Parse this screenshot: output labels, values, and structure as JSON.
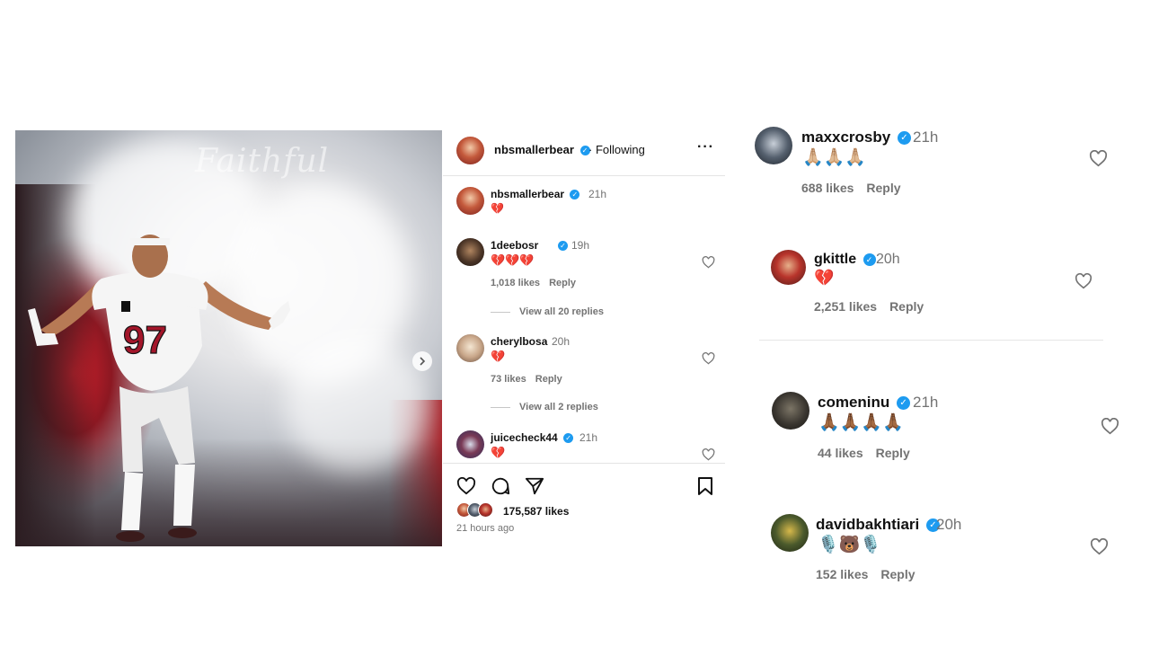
{
  "post": {
    "author": "nbsmallerbear",
    "follow_state": "· Following",
    "more_label": "···",
    "caption_emoji": "💔",
    "caption_time": "21h",
    "likes": "175,587 likes",
    "time_ago": "21 hours ago",
    "photo_banner": "Faithful"
  },
  "comments": [
    {
      "user": "1deebosr",
      "time": "19h",
      "text": "💔💔💔",
      "likes": "1,018 likes",
      "reply": "Reply",
      "view_replies": "View all 20 replies"
    },
    {
      "user": "cherylbosa",
      "time": "20h",
      "text": "💔",
      "likes": "73 likes",
      "reply": "Reply",
      "view_replies": "View all 2 replies"
    },
    {
      "user": "juicecheck44",
      "time": "21h",
      "text": "💔"
    }
  ],
  "zoomed": [
    {
      "user": "maxxcrosby",
      "time": "21h",
      "text": "🙏🏼🙏🏼🙏🏼",
      "likes": "688 likes",
      "reply": "Reply"
    },
    {
      "user": "gkittle",
      "time": "20h",
      "text": "💔",
      "likes": "2,251 likes",
      "reply": "Reply"
    },
    {
      "user": "comeninu",
      "time": "21h",
      "text": "🙏🏾🙏🏾🙏🏾🙏🏾",
      "likes": "44 likes",
      "reply": "Reply"
    },
    {
      "user": "davidbakhtiari",
      "time": "20h",
      "text": "🎙️🐻🎙️",
      "likes": "152 likes",
      "reply": "Reply"
    }
  ],
  "icons": {
    "verified": "verified-badge-icon",
    "heart": "heart-outline-icon",
    "comment": "comment-bubble-icon",
    "share": "paper-plane-icon",
    "save": "bookmark-icon",
    "next": "chevron-right-icon"
  },
  "colors": {
    "verified": "#1d9bf0",
    "muted": "#737373",
    "jersey_red": "#a3162a"
  }
}
